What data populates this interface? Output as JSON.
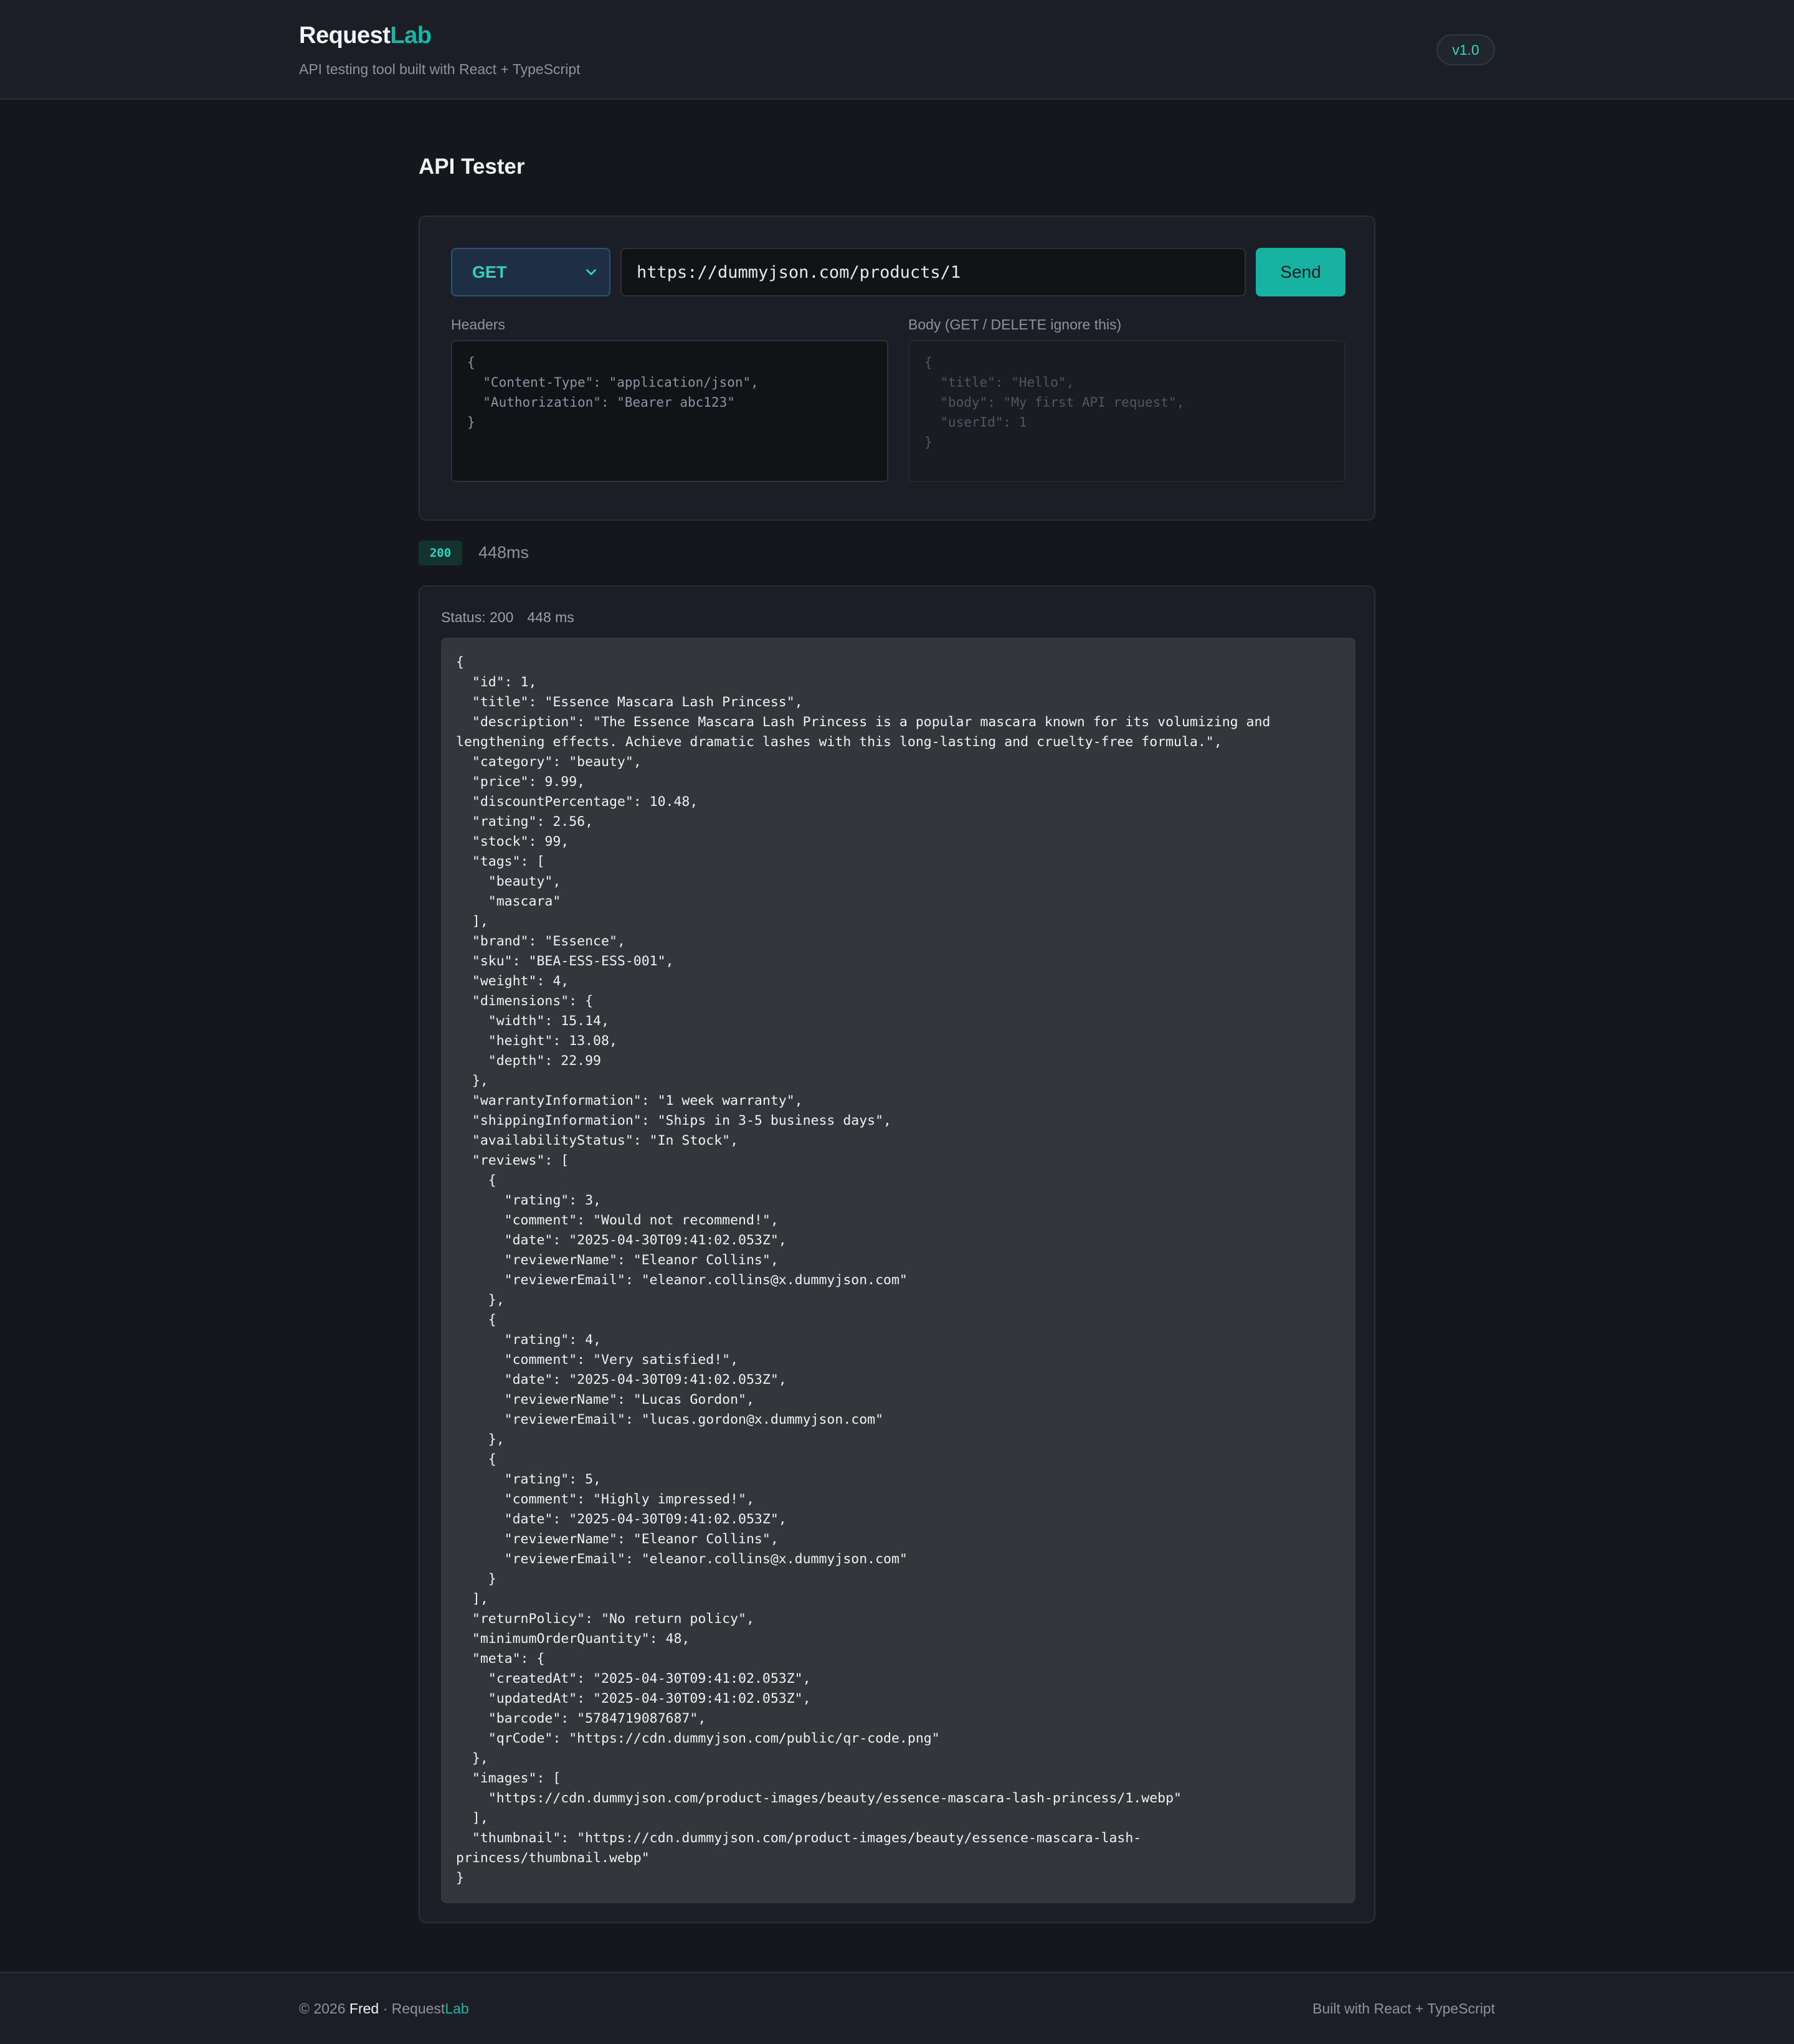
{
  "header": {
    "brand_main": "Request",
    "brand_accent": "Lab",
    "tagline": "API testing tool built with React + TypeScript",
    "version": "v1.0"
  },
  "page": {
    "title": "API Tester"
  },
  "request": {
    "method": "GET",
    "url": "https://dummyjson.com/products/1",
    "send_label": "Send",
    "headers_label": "Headers",
    "body_label": "Body (GET / DELETE ignore this)",
    "headers_value": "{\n  \"Content-Type\": \"application/json\",\n  \"Authorization\": \"Bearer abc123\"\n}",
    "body_placeholder": "{\n  \"title\": \"Hello\",\n  \"body\": \"My first API request\",\n  \"userId\": 1\n}"
  },
  "status": {
    "code": "200",
    "time": "448ms"
  },
  "response": {
    "status_text": "Status: 200",
    "time_text": "448 ms",
    "body": "{\n  \"id\": 1,\n  \"title\": \"Essence Mascara Lash Princess\",\n  \"description\": \"The Essence Mascara Lash Princess is a popular mascara known for its volumizing and\nlengthening effects. Achieve dramatic lashes with this long-lasting and cruelty-free formula.\",\n  \"category\": \"beauty\",\n  \"price\": 9.99,\n  \"discountPercentage\": 10.48,\n  \"rating\": 2.56,\n  \"stock\": 99,\n  \"tags\": [\n    \"beauty\",\n    \"mascara\"\n  ],\n  \"brand\": \"Essence\",\n  \"sku\": \"BEA-ESS-ESS-001\",\n  \"weight\": 4,\n  \"dimensions\": {\n    \"width\": 15.14,\n    \"height\": 13.08,\n    \"depth\": 22.99\n  },\n  \"warrantyInformation\": \"1 week warranty\",\n  \"shippingInformation\": \"Ships in 3-5 business days\",\n  \"availabilityStatus\": \"In Stock\",\n  \"reviews\": [\n    {\n      \"rating\": 3,\n      \"comment\": \"Would not recommend!\",\n      \"date\": \"2025-04-30T09:41:02.053Z\",\n      \"reviewerName\": \"Eleanor Collins\",\n      \"reviewerEmail\": \"eleanor.collins@x.dummyjson.com\"\n    },\n    {\n      \"rating\": 4,\n      \"comment\": \"Very satisfied!\",\n      \"date\": \"2025-04-30T09:41:02.053Z\",\n      \"reviewerName\": \"Lucas Gordon\",\n      \"reviewerEmail\": \"lucas.gordon@x.dummyjson.com\"\n    },\n    {\n      \"rating\": 5,\n      \"comment\": \"Highly impressed!\",\n      \"date\": \"2025-04-30T09:41:02.053Z\",\n      \"reviewerName\": \"Eleanor Collins\",\n      \"reviewerEmail\": \"eleanor.collins@x.dummyjson.com\"\n    }\n  ],\n  \"returnPolicy\": \"No return policy\",\n  \"minimumOrderQuantity\": 48,\n  \"meta\": {\n    \"createdAt\": \"2025-04-30T09:41:02.053Z\",\n    \"updatedAt\": \"2025-04-30T09:41:02.053Z\",\n    \"barcode\": \"5784719087687\",\n    \"qrCode\": \"https://cdn.dummyjson.com/public/qr-code.png\"\n  },\n  \"images\": [\n    \"https://cdn.dummyjson.com/product-images/beauty/essence-mascara-lash-princess/1.webp\"\n  ],\n  \"thumbnail\": \"https://cdn.dummyjson.com/product-images/beauty/essence-mascara-lash-\nprincess/thumbnail.webp\"\n}"
  },
  "footer": {
    "copyright": "© 2026",
    "author": "Fred",
    "separator": "·",
    "brand_main": "Request",
    "brand_accent": "Lab",
    "built_with": "Built with React + TypeScript"
  },
  "colors": {
    "accent": "#18b8a8",
    "background": "#15171c",
    "panel": "#1b1e24"
  }
}
